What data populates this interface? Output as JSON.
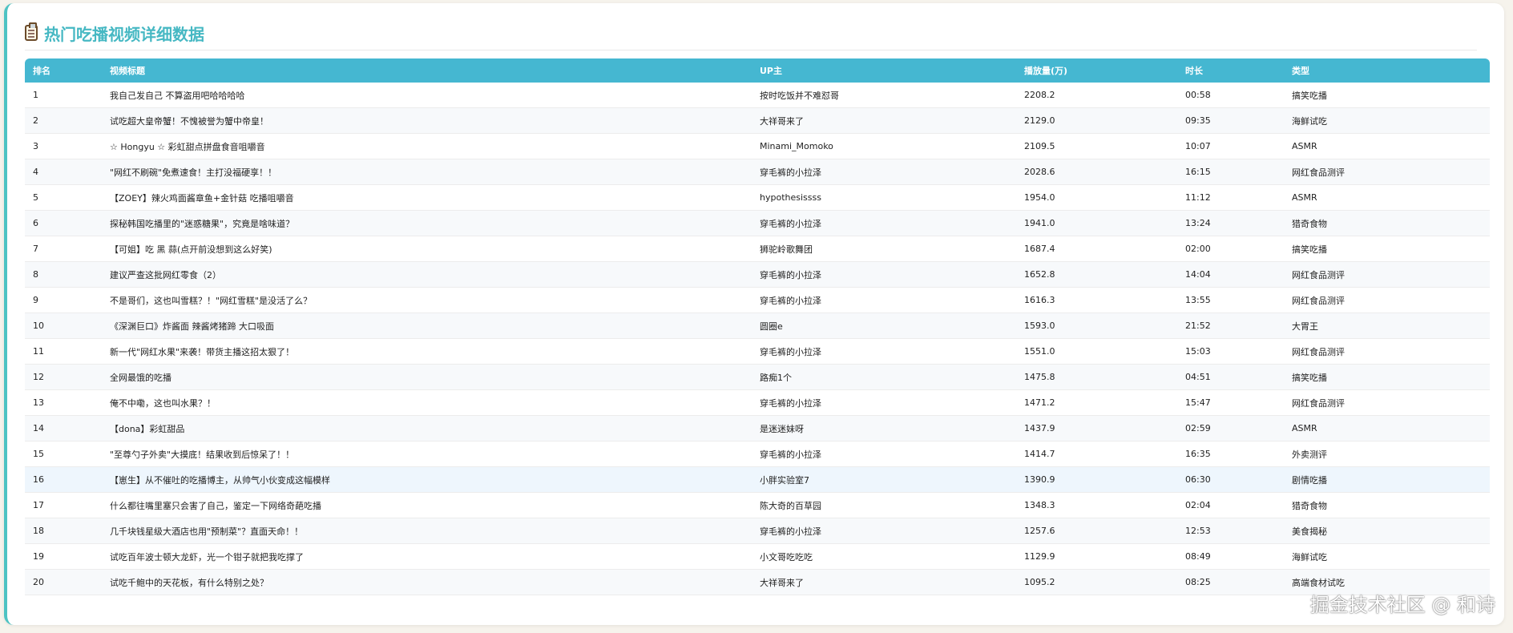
{
  "panel": {
    "title": "热门吃播视频详细数据",
    "icon": "clipboard-icon"
  },
  "table": {
    "columns": [
      "排名",
      "视频标题",
      "UP主",
      "播放量(万)",
      "时长",
      "类型"
    ],
    "rows": [
      [
        "1",
        "我自己发自己 不算盗用吧哈哈哈哈",
        "按时吃饭并不难怼哥",
        "2208.2",
        "00:58",
        "搞笑吃播"
      ],
      [
        "2",
        "试吃超大皇帝蟹！不愧被誉为蟹中帝皇！",
        "大祥哥来了",
        "2129.0",
        "09:35",
        "海鲜试吃"
      ],
      [
        "3",
        "☆ Hongyu ☆ 彩虹甜点拼盘食音咀嚼音",
        "Minami_Momoko",
        "2109.5",
        "10:07",
        "ASMR"
      ],
      [
        "4",
        "\"网红不刷碗\"免煮速食！主打没福硬享！！",
        "穿毛裤的小拉泽",
        "2028.6",
        "16:15",
        "网红食品测评"
      ],
      [
        "5",
        "【ZOEY】辣火鸡面酱章鱼+金针菇 吃播咀嚼音",
        "hypothesissss",
        "1954.0",
        "11:12",
        "ASMR"
      ],
      [
        "6",
        "探秘韩国吃播里的\"迷惑糖果\"，究竟是啥味道？",
        "穿毛裤的小拉泽",
        "1941.0",
        "13:24",
        "猎奇食物"
      ],
      [
        "7",
        "【可姐】吃 黑 蒜(点开前没想到这么好笑)",
        "狮驼岭歌舞团",
        "1687.4",
        "02:00",
        "搞笑吃播"
      ],
      [
        "8",
        "建议严查这批网红零食（2）",
        "穿毛裤的小拉泽",
        "1652.8",
        "14:04",
        "网红食品测评"
      ],
      [
        "9",
        "不是哥们，这也叫雪糕？！\"网红雪糕\"是没活了么？",
        "穿毛裤的小拉泽",
        "1616.3",
        "13:55",
        "网红食品测评"
      ],
      [
        "10",
        "《深渊巨口》炸酱面 辣酱烤猪蹄 大口吸面",
        "圆圈e",
        "1593.0",
        "21:52",
        "大胃王"
      ],
      [
        "11",
        "新一代\"网红水果\"来袭！带货主播这招太狠了！",
        "穿毛裤的小拉泽",
        "1551.0",
        "15:03",
        "网红食品测评"
      ],
      [
        "12",
        "全网最饿的吃播",
        "路痴1个",
        "1475.8",
        "04:51",
        "搞笑吃播"
      ],
      [
        "13",
        "俺不中嘞，这也叫水果？！",
        "穿毛裤的小拉泽",
        "1471.2",
        "15:47",
        "网红食品测评"
      ],
      [
        "14",
        "【dona】彩虹甜品",
        "是迷迷妹呀",
        "1437.9",
        "02:59",
        "ASMR"
      ],
      [
        "15",
        "\"至尊勺子外卖\"大摸底！结果收到后惊呆了！！",
        "穿毛裤的小拉泽",
        "1414.7",
        "16:35",
        "外卖测评"
      ],
      [
        "16",
        "【崽生】从不催吐的吃播博主，从帅气小伙变成这幅模样",
        "小胖实验室7",
        "1390.9",
        "06:30",
        "剧情吃播"
      ],
      [
        "17",
        "什么都往嘴里塞只会害了自己，鉴定一下网络奇葩吃播",
        "陈大奇的百草园",
        "1348.3",
        "02:04",
        "猎奇食物"
      ],
      [
        "18",
        "几千块钱星级大酒店也用\"预制菜\"？直面天命！！",
        "穿毛裤的小拉泽",
        "1257.6",
        "12:53",
        "美食揭秘"
      ],
      [
        "19",
        "试吃百年波士顿大龙虾，光一个钳子就把我吃撑了",
        "小文哥吃吃吃",
        "1129.9",
        "08:49",
        "海鲜试吃"
      ],
      [
        "20",
        "试吃千鲍中的天花板，有什么特别之处？",
        "大祥哥来了",
        "1095.2",
        "08:25",
        "高端食材试吃"
      ]
    ]
  },
  "watermark": "掘金技术社区 @ 和诗"
}
